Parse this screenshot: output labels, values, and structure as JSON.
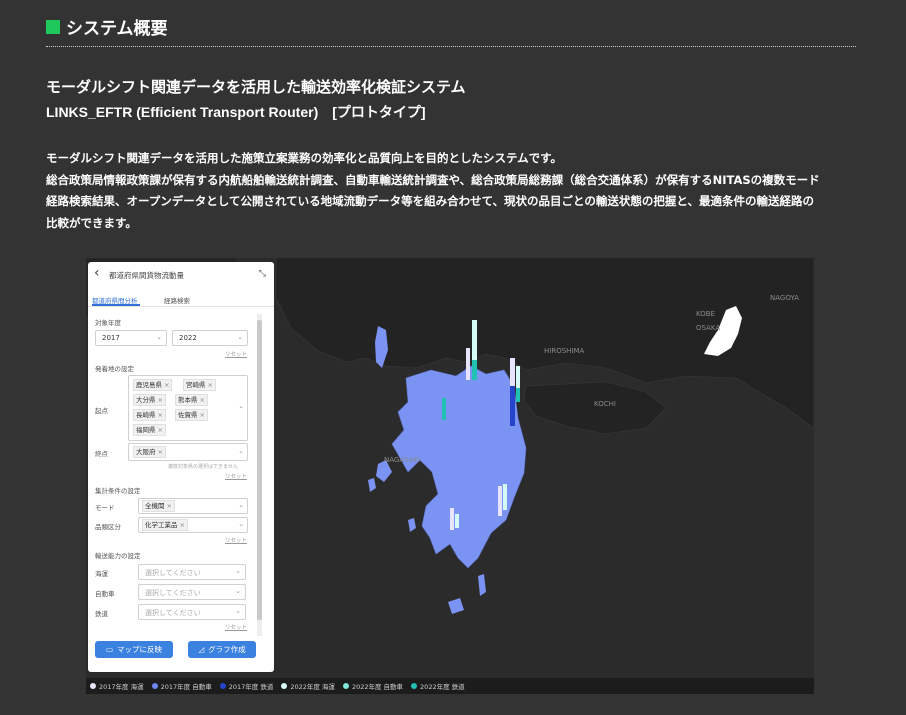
{
  "section": {
    "title": "システム概要"
  },
  "heading": {
    "line1": "モーダルシフト関連データを活用した輸送効率化検証システム",
    "line2": "LINKS_EFTR (Efficient Transport Router)　[プロトタイプ]"
  },
  "description": [
    "モーダルシフト関連データを活用した施策立案業務の効率化と品質向上を目的としたシステムです。",
    "総合政策局情報政策課が保有する内航船舶輸送統計調査、自動車輸送統計調査や、総合政策局総務課（総合交通体系）が保有するNITASの複数モード",
    "経路検索結果、オープンデータとして公開されている地域流動データ等を組み合わせて、現状の品目ごとの輸送状態の把握と、最適条件の輸送経路の",
    "比較ができます。"
  ],
  "panel": {
    "title": "都道府県間貨物流動量",
    "tabs": [
      "都道府県間分析",
      "経路検索"
    ],
    "year_label": "対象年度",
    "year_from": "2017",
    "year_to": "2022",
    "reset": "リセット",
    "origin_section": "発着地の設定",
    "origin_label": "起点",
    "origin_tags": [
      "鹿児島県",
      "宮崎県",
      "大分県",
      "熊本県",
      "長崎県",
      "佐賀県",
      "福岡県"
    ],
    "dest_label": "終点",
    "dest_tags": [
      "大阪府"
    ],
    "dest_note": "複数対象県の選択はできません",
    "agg_section": "集計条件の設定",
    "mode_label": "モード",
    "mode_tags": [
      "全機関"
    ],
    "category_label": "品類区分",
    "category_tags": [
      "化学工業品"
    ],
    "capacity_section": "輸送能力の設定",
    "capacity_rows": [
      {
        "label": "海運",
        "placeholder": "選択してください"
      },
      {
        "label": "自動車",
        "placeholder": "選択してください"
      },
      {
        "label": "鉄道",
        "placeholder": "選択してください"
      }
    ],
    "btn_map": "マップに反映",
    "btn_graph": "グラフ作成"
  },
  "map": {
    "labels": [
      "HIROSHIMA",
      "KOCHI",
      "NAGASAKI",
      "OSAKA",
      "NAGOYA",
      "KOBE"
    ],
    "region_color": "#7b93f2",
    "highlight_color": "#ffffff"
  },
  "legend": [
    {
      "label": "2017年度 海運",
      "color": "#e7e4ff"
    },
    {
      "label": "2017年度 自動車",
      "color": "#6f86f0"
    },
    {
      "label": "2017年度 鉄道",
      "color": "#2445c9"
    },
    {
      "label": "2022年度 海運",
      "color": "#d6fbf6"
    },
    {
      "label": "2022年度 自動車",
      "color": "#7fe6dc"
    },
    {
      "label": "2022年度 鉄道",
      "color": "#20c0b2"
    }
  ]
}
